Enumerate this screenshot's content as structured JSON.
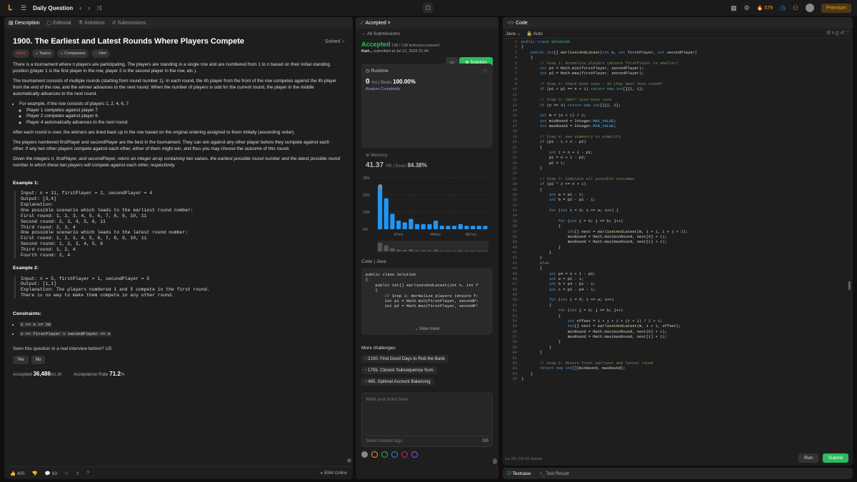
{
  "topbar": {
    "title": "Daily Question",
    "streak": "579",
    "premium": "Premium"
  },
  "left": {
    "tabs": [
      "Description",
      "Editorial",
      "Solutions",
      "Submissions"
    ],
    "title": "1900. The Earliest and Latest Rounds Where Players Compete",
    "solved": "Solved",
    "tags": [
      "Hard",
      "Topics",
      "Companies",
      "Hint"
    ],
    "p1": "There is a tournament where n players are participating. The players are standing in a single row and are numbered from 1 to n based on their initial standing position (player 1 is the first player in the row, player 2 is the second player in the row, etc.).",
    "p2": "The tournament consists of multiple rounds (starting from round number 1). In each round, the ith player from the front of the row competes against the ith player from the end of the row, and the winner advances to the next round. When the number of players is odd for the current round, the player in the middle automatically advances to the next round.",
    "b1": "For example, if the row consists of players 1, 2, 4, 6, 7",
    "b1a": "Player 1 competes against player 7.",
    "b1b": "Player 2 competes against player 6.",
    "b1c": "Player 4 automatically advances to the next round.",
    "p3": "After each round is over, the winners are lined back up in the row based on the original ordering assigned to them initially (ascending order).",
    "p4": "The players numbered firstPlayer and secondPlayer are the best in the tournament. They can win against any other player before they compete against each other. If any two other players compete against each other, either of them might win, and thus you may choose the outcome of this round.",
    "p5": "Given the integers n, firstPlayer, and secondPlayer, return an integer array containing two values, the earliest possible round number and the latest possible round number in which these two players will compete against each other, respectively.",
    "ex1_title": "Example 1:",
    "ex1": "Input: n = 11, firstPlayer = 2, secondPlayer = 4\nOutput: [3,4]\nExplanation:\nOne possible scenario which leads to the earliest round number:\nFirst round: 1, 2, 3, 4, 5, 6, 7, 8, 9, 10, 11\nSecond round: 2, 3, 4, 5, 6, 11\nThird round: 2, 3, 4\nOne possible scenario which leads to the latest round number:\nFirst round: 1, 2, 3, 4, 5, 6, 7, 8, 9, 10, 11\nSecond round: 1, 2, 3, 4, 5, 6\nThird round: 1, 2, 4\nFourth round: 2, 4",
    "ex2_title": "Example 2:",
    "ex2": "Input: n = 5, firstPlayer = 1, secondPlayer = 5\nOutput: [1,1]\nExplanation: The players numbered 1 and 5 compete in the first round.\nThere is no way to make them compete in any other round.",
    "constraints_title": "Constraints:",
    "c1": "2 <= n <= 28",
    "c2": "1 <= firstPlayer < secondPlayer <= n",
    "interview": "Seen this question in a real interview before?   1/5",
    "yes": "Yes",
    "no": "No",
    "accepted_label": "Accepted",
    "accepted_val": "36,486",
    "accepted_total": "/51.2K",
    "rate_label": "Acceptance Rate",
    "rate_val": "71.2",
    "likes": "405",
    "comments": "83",
    "online": "5084 Online"
  },
  "mid": {
    "tab": "Accepted",
    "all": "All Submissions",
    "status": "Accepted",
    "passed": "138 / 138 testcases passed",
    "user": "Kart...",
    "submitted": "submitted at Jul 12, 2025 21:44",
    "solution_btn": "Solution",
    "runtime_label": "Runtime",
    "runtime_val": "0",
    "runtime_unit": "ms",
    "beats_label": "Beats",
    "runtime_beats": "100.00%",
    "analyze": "Analyze Complexity",
    "memory_label": "Memory",
    "memory_val": "41.37",
    "memory_unit": "MB",
    "memory_beats": "84.38%",
    "code_label": "Code | Java",
    "code": "public class Solution\n{\n    public int[] earliestAndLatest(int n, int f\n    {\n        // Step 1: Normalize players (ensure f:\n        int p1 = Math.min(firstPlayer, secondP!\n        int p2 = Math.max(firstPlayer, secondP!",
    "view_more": "View more",
    "more": "More challenges",
    "challenges": [
      "2100. Find Good Days to Rob the Bank",
      "1755. Closest Subsequence Sum",
      "465. Optimal Account Balancing"
    ],
    "notes": "Write your notes here",
    "related": "Select related tags",
    "count": "0/5"
  },
  "chart_data": {
    "type": "bar",
    "ylabels": [
      "30%",
      "20%",
      "10%",
      "0%"
    ],
    "xlabels": [
      "87ms",
      "444ms",
      "887ms"
    ],
    "values": [
      25,
      18,
      9,
      5,
      4,
      6,
      3,
      3,
      3,
      5,
      2,
      2,
      2,
      3,
      2,
      2,
      2,
      2
    ],
    "ylim": [
      0,
      30
    ]
  },
  "right": {
    "tab": "Code",
    "lang": "Java",
    "auto": "Auto",
    "status": "Ln 29, Col 10   Saved",
    "run": "Run",
    "submit": "Submit"
  },
  "testbar": {
    "t1": "Testcase",
    "t2": "Test Result"
  }
}
